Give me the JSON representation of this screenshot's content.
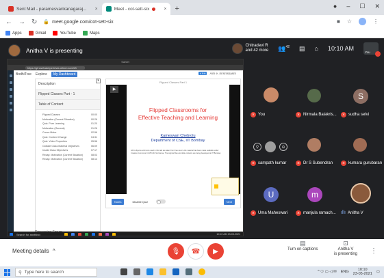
{
  "browser": {
    "tabs": [
      {
        "label": "Sent Mail - paramesvarikanagaraj...",
        "active": false,
        "icon": "gmail-icon"
      },
      {
        "label": "Meet - cot-sett-six",
        "active": true,
        "icon": "meet-icon"
      }
    ],
    "new_tab": "+",
    "url": "meet.google.com/cot-sett-six",
    "bookmarks": [
      "Apps",
      "Gmail",
      "YouTube",
      "Maps"
    ]
  },
  "meet": {
    "presenting_text": "Anitha V is presenting",
    "chip_name": "Chitradevi R",
    "chip_more": "and 42 more",
    "participant_count": "42",
    "time": "10:10 AM",
    "you_label": "You"
  },
  "screen": {
    "window_title": "Sarket",
    "url": "https://gtnswfnatetpe.btvia.otlrxm.scn/1B",
    "nav": [
      "BodhiTree",
      "Explore",
      "My Dashboard"
    ],
    "login_tag": "KRN",
    "login_user": "Aim e .mrsrsssasrn",
    "toc_header": "Description",
    "toc_sub": "Flipped Classes Part - 1",
    "toc_title": "Table of Content",
    "toc_items": [
      {
        "label": "Flipped Classes",
        "time": "00:00"
      },
      {
        "label": "Motivation (Current Situation)",
        "time": "00:26"
      },
      {
        "label": "Quiz: Pure Learning",
        "time": "01:20"
      },
      {
        "label": "Motivation (General)",
        "time": "01:26"
      },
      {
        "label": "Convo Motor",
        "time": "02:56"
      },
      {
        "label": "Quiz: Content Change",
        "time": "04:31"
      },
      {
        "label": "Quiz: Video Properties",
        "time": "05:56"
      },
      {
        "label": "Outside Class Material Objectives",
        "time": "06:09"
      },
      {
        "label": "Inside Class Objectives",
        "time": "07:17"
      },
      {
        "label": "Recap: Motivation (Current Situation)",
        "time": "08:03"
      },
      {
        "label": "Recap: Motivation (Current Situation)",
        "time": "08:14"
      }
    ],
    "toc_bottom": "Discussion Forum",
    "slide_label": "Flipped Classes Part 1",
    "slide_title_line1": "Flipped Classrooms for",
    "slide_title_line2": "Effective Teaching and Learning",
    "slide_author": "Kameswari Chebrolu",
    "slide_dept": "Department of CSE, IIT Bombay",
    "slide_foot": "All the figures and icons used in this talk are taken from free source the material has been made available under Creative Commons CC-BY-NC-SA license. The original files and slide contents are being developed at IIT Bombay.",
    "btn_left": "Notes",
    "toggle_label": "Disable Quiz",
    "btn_right": "Next",
    "taskbar_search": "Search for anything",
    "taskbar_time": "10:10 AM 23-05-2021"
  },
  "participants": [
    {
      "name": "You",
      "muted": true
    },
    {
      "name": "Nirmala Balakris...",
      "muted": true
    },
    {
      "name": "sudha selvi",
      "muted": true,
      "letter": "S",
      "color": "#8d6e63"
    },
    {
      "name": "sampath kumar",
      "muted": true
    },
    {
      "name": "Dr S Subendran",
      "muted": true
    },
    {
      "name": "kumara gurubaran",
      "muted": true
    },
    {
      "name": "Uma Maheswari",
      "muted": true,
      "letter": "U",
      "color": "#5c6bc0"
    },
    {
      "name": "manjula ramach...",
      "muted": true,
      "letter": "m",
      "color": "#ab47bc"
    },
    {
      "name": "Anitha V",
      "muted": false
    }
  ],
  "controls": {
    "meeting_details": "Meeting details",
    "captions": "Turn on captions",
    "presenting_line1": "Anitha V",
    "presenting_line2": "is presenting"
  },
  "taskbar": {
    "search_placeholder": "Type here to search",
    "lang": "ENG",
    "time": "10:10",
    "date": "23-05-2021"
  },
  "colors": {
    "meet_bg": "#202124",
    "mute_red": "#ea4335",
    "accent_blue": "#3c7cd2"
  }
}
